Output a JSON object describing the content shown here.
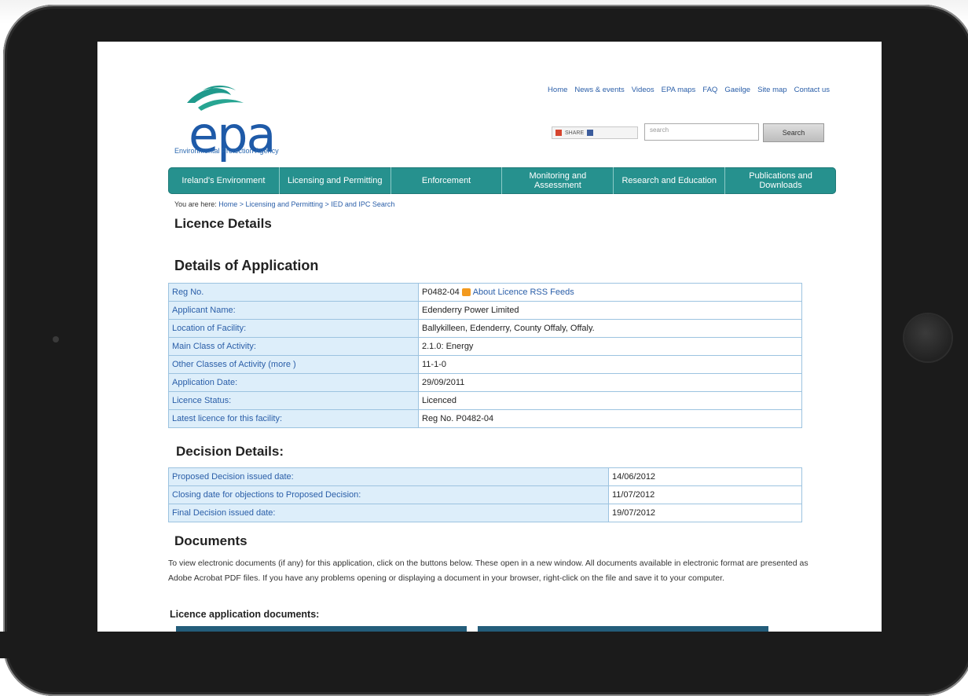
{
  "header": {
    "logo_text": "epa",
    "logo_subtitle": "Environmental Protection Agency",
    "top_links": [
      "Home",
      "News & events",
      "Videos",
      "EPA maps",
      "FAQ",
      "Gaeilge",
      "Site map",
      "Contact us"
    ],
    "share_label": "SHARE",
    "search_placeholder": "search",
    "search_button": "Search"
  },
  "nav": [
    "Ireland's Environment",
    "Licensing and Permitting",
    "Enforcement",
    "Monitoring and Assessment",
    "Research and Education",
    "Publications and Downloads"
  ],
  "breadcrumb": {
    "prefix": "You are here:",
    "path": "Home > Licensing and Permitting > IED and IPC Search"
  },
  "page_title": "Licence Details",
  "application": {
    "heading": "Details of Application",
    "rows": [
      {
        "label": "Reg No.",
        "value": "P0482-04"
      },
      {
        "label": "Applicant Name:",
        "value": "Edenderry Power Limited"
      },
      {
        "label": "Location of Facility:",
        "value": "Ballykilleen, Edenderry, County Offaly, Offaly."
      },
      {
        "label": "Main Class of Activity:",
        "value": "2.1.0: Energy"
      },
      {
        "label": "Other Classes of Activity (more )",
        "value": "11-1-0"
      },
      {
        "label": "Application Date:",
        "value": "29/09/2011"
      },
      {
        "label": "Licence Status:",
        "value": "Licenced"
      },
      {
        "label": "Latest licence for this facility:",
        "value": "Reg No. P0482-04"
      }
    ],
    "rss_link": "About Licence RSS Feeds"
  },
  "decision": {
    "heading": "Decision Details:",
    "rows": [
      {
        "label": "Proposed Decision issued date:",
        "value": "14/06/2012"
      },
      {
        "label": "Closing date for objections to Proposed Decision:",
        "value": "11/07/2012"
      },
      {
        "label": "Final Decision issued date:",
        "value": "19/07/2012"
      }
    ]
  },
  "documents": {
    "heading": "Documents",
    "text": "To view electronic documents (if any) for this application, click on the buttons below. These open in a new window. All documents available in electronic format are presented as Adobe Acrobat PDF files. If you have any problems opening or displaying a document in your browser, right-click on the file and save it to your computer.",
    "subheading": "Licence application documents:"
  },
  "colors": {
    "nav_teal": "#26918e",
    "link_blue": "#2a5ea8",
    "label_cell_bg": "#ddeefa",
    "tablet_frame": "#1b1b1b"
  }
}
